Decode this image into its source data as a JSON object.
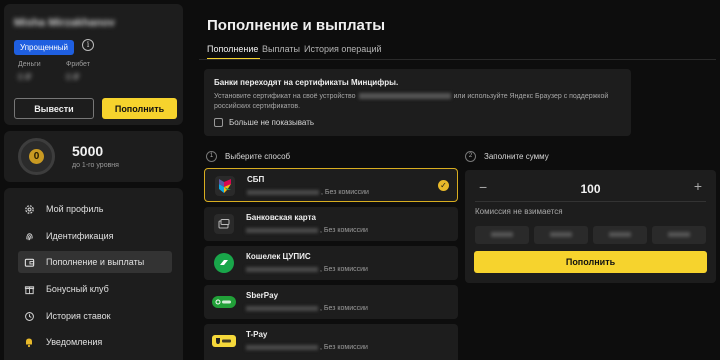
{
  "account": {
    "username": "Misha Mirzakhanov",
    "status_badge": "Упрощенный",
    "balances": [
      {
        "label": "Деньги",
        "value": "0 ₽"
      },
      {
        "label": "Фрибет",
        "value": "0 ₽"
      }
    ],
    "withdraw_label": "Вывести",
    "topup_label": "Пополнить"
  },
  "level": {
    "badge_value": "0",
    "points": "5000",
    "caption": "до 1-го уровня"
  },
  "menu": {
    "items": [
      {
        "label": "Мой профиль",
        "icon": "gear-icon"
      },
      {
        "label": "Идентификация",
        "icon": "fingerprint-icon"
      },
      {
        "label": "Пополнение и выплаты",
        "icon": "wallet-icon",
        "active": true
      },
      {
        "label": "Бонусный клуб",
        "icon": "gift-icon"
      },
      {
        "label": "История ставок",
        "icon": "history-icon"
      },
      {
        "label": "Уведомления",
        "icon": "bell-icon"
      }
    ]
  },
  "page": {
    "title": "Пополнение и выплаты",
    "tabs": [
      "Пополнение",
      "Выплаты",
      "История операций"
    ]
  },
  "notice": {
    "heading": "Банки переходят на сертификаты Минцифры.",
    "text_before": "Установите сертификат на своё устройство",
    "text_after": "или используйте Яндекс Браузер с поддержкой российских сертификатов.",
    "checkbox_label": "Больше не показывать"
  },
  "steps": {
    "choose": {
      "num": "1",
      "label": "Выберите способ"
    },
    "amount": {
      "num": "2",
      "label": "Заполните сумму"
    }
  },
  "methods": [
    {
      "name": "СБП",
      "fee": ", Без комиссии",
      "selected": true
    },
    {
      "name": "Банковская карта",
      "fee": ", Без комиссии"
    },
    {
      "name": "Кошелек ЦУПИС",
      "fee": ", Без комиссии"
    },
    {
      "name": "SberPay",
      "fee": ", Без комиссии"
    },
    {
      "name": "T-Pay",
      "fee": ", Без комиссии"
    }
  ],
  "amount": {
    "value": "100",
    "fee_text": "Комиссия не взимается",
    "submit_label": "Пополнить"
  },
  "colors": {
    "accent": "#f6d32d",
    "badge": "#1f5fe0",
    "background": "#0d0d0d",
    "card": "#1d1d1d"
  }
}
